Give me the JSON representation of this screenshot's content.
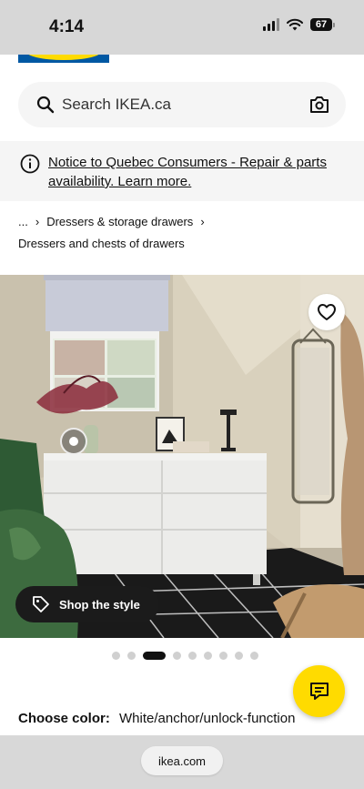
{
  "status_bar": {
    "time": "4:14",
    "battery": "67"
  },
  "search": {
    "placeholder": "Search IKEA.ca"
  },
  "notice": {
    "text": "Notice to Quebec Consumers - Repair & parts availability. Learn more."
  },
  "breadcrumb": {
    "ellipsis": "...",
    "parent": "Dressers & storage drawers",
    "current": "Dressers and chests of drawers"
  },
  "hero": {
    "shop_style_label": "Shop the style"
  },
  "carousel": {
    "total": 9,
    "active_index": 2
  },
  "product": {
    "choose_color_label": "Choose color:",
    "color_value": "White/anchor/unlock-function"
  },
  "browser": {
    "url": "ikea.com"
  },
  "colors": {
    "ikea_blue": "#0058a3",
    "ikea_yellow": "#ffdb00"
  },
  "icons": [
    "search-icon",
    "camera-icon",
    "info-icon",
    "chevron-right-icon",
    "heart-icon",
    "tag-icon",
    "chat-icon",
    "wifi-icon",
    "signal-icon",
    "battery-icon"
  ]
}
